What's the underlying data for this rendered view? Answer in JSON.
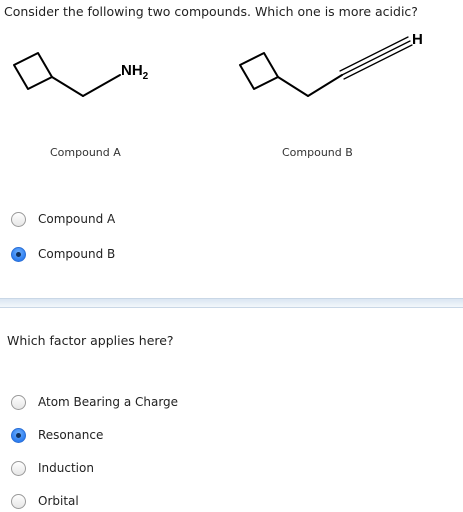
{
  "question1": {
    "text": "Consider the following two compounds. Which one is more acidic?",
    "compound_a": {
      "label": "Compound A",
      "substituent": "NH",
      "substituent_subscript": "2"
    },
    "compound_b": {
      "label": "Compound B",
      "terminal_atom": "H"
    },
    "options": [
      {
        "label": "Compound A",
        "selected": false
      },
      {
        "label": "Compound B",
        "selected": true
      }
    ]
  },
  "question2": {
    "text": "Which factor applies here?",
    "options": [
      {
        "label": "Atom Bearing a Charge",
        "selected": false
      },
      {
        "label": "Resonance",
        "selected": true
      },
      {
        "label": "Induction",
        "selected": false
      },
      {
        "label": "Orbital",
        "selected": false
      }
    ]
  },
  "colors": {
    "radio_selected": "#2e7ef0",
    "divider": "#dbe6f2",
    "bond": "#000000"
  }
}
